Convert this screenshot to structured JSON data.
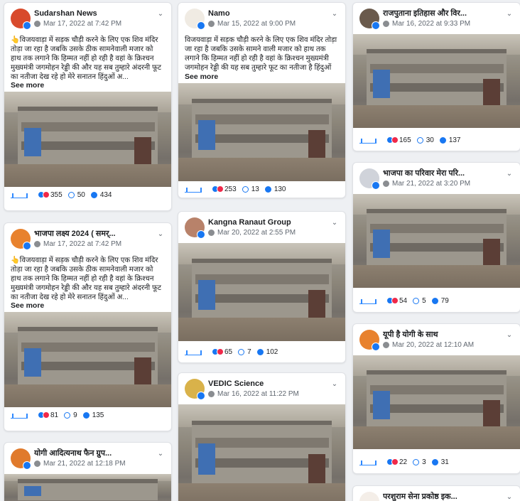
{
  "post_text": "👆विजयवाड़ा में सड़क चौड़ी करने के लिए एक शिव मंदिर तोड़ा जा रहा है जबकि उसके ठीक सामनेवाली मजार को हाथ तक लगाने कि हिम्मत नहीं हो रही है वहां के क्रिश्चन मुख्यमंत्री जगमोहन रेड्डी की और यह सब तुम्हारे अंदरनी फूट का नतीजा देख रहे हो मेरे सनातन हिंदुओं अ...",
  "post_text_namo": "विजयवाड़ा में सड़क चौड़ी करने के लिए एक शिव मंदिर तोड़ा जा रहा है जबकि उसके सामने वाली मजार को हाथ तक लगाने कि हिम्मत नहीं हो रही है वहां के क्रिश्चन मुख्यमंत्री जगमोहन रेड्डी की यह सब तुम्हारे फूट का नतीजा है हिंदुओं",
  "see_more": "See more",
  "posts": [
    {
      "name": "Sudarshan News",
      "time": "Mar 17, 2022 at 7:42 PM",
      "reactions": "355",
      "comments": "50",
      "shares": "434",
      "avatar_color": "#d84a2c"
    },
    {
      "name": "भाजपा लक्ष्य 2024 ( समर्...",
      "time": "Mar 17, 2022 at 7:42 PM",
      "reactions": "81",
      "comments": "9",
      "shares": "135",
      "avatar_color": "#e8822e"
    },
    {
      "name": "योगी आदित्यनाथ फैन ग्रुप...",
      "time": "Mar 21, 2022 at 12:18 PM",
      "avatar_color": "#e07a2c"
    },
    {
      "name": "Namo",
      "time": "Mar 15, 2022 at 9:00 PM",
      "reactions": "253",
      "comments": "13",
      "shares": "130",
      "avatar_color": "#f0ebe3"
    },
    {
      "name": "Kangna Ranaut Group",
      "time": "Mar 20, 2022 at 2:55 PM",
      "reactions": "65",
      "comments": "7",
      "shares": "102",
      "avatar_color": "#b8826a"
    },
    {
      "name": "VEDIC Science",
      "time": "Mar 16, 2022 at 11:22 PM",
      "avatar_color": "#d9b24a"
    },
    {
      "name": "राजपुताना इतिहास और विर...",
      "time": "Mar 16, 2022 at 9:33 PM",
      "reactions": "165",
      "comments": "30",
      "shares": "137",
      "avatar_color": "#6a5a4c"
    },
    {
      "name": "भाजपा का परिवार मेरा परि...",
      "time": "Mar 21, 2022 at 3:20 PM",
      "reactions": "54",
      "comments": "5",
      "shares": "79",
      "avatar_color": "#d0d3da"
    },
    {
      "name": "यूपी है योगी के साथ",
      "time": "Mar 20, 2022 at 12:10 AM",
      "reactions": "22",
      "comments": "3",
      "shares": "31",
      "avatar_color": "#e8822e"
    },
    {
      "name": "परशुराम सेना प्रकोष्ठ इक...",
      "avatar_color": "#f4eee8"
    }
  ]
}
